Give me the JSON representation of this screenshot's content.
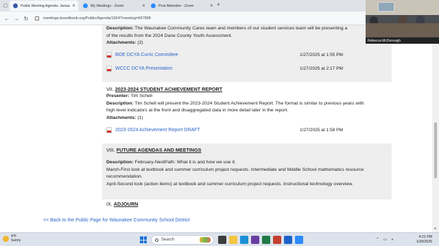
{
  "browser": {
    "tabs": [
      {
        "title": "Public Meeting Agenda: Janua",
        "active": true,
        "favicon_color": "#3b5ba9"
      },
      {
        "title": "My Meetings - Zoom",
        "active": false,
        "favicon_color": "#2d8cff"
      },
      {
        "title": "Post Attendee - Zoom",
        "active": false,
        "favicon_color": "#2d8cff"
      }
    ],
    "url": "meetings.boardbook.org/Public/Agenda/1924?meeting=667898"
  },
  "agenda": {
    "top_section": {
      "description_label": "Description:",
      "description_text": " The Waunakee Community Cares team and members of our student services team will be presenting a",
      "description_cont": "of the results from the 2024 Dane County Youth Assessment.",
      "attachments_label": "Attachments:",
      "attachments_count": " (2)",
      "attachments": [
        {
          "name": "BOE DCYA Curric Committee",
          "date": "1/27/2025 at 1:55 PM"
        },
        {
          "name": "WCCC DCYA Presentation",
          "date": "1/27/2025 at 2:17 PM"
        }
      ]
    },
    "item7": {
      "number": "VII.",
      "title": "2023-2024 STUDENT ACHIEVEMENT REPORT",
      "presenter_label": "Presenter:",
      "presenter": " Tim Schell",
      "description_label": "Description:",
      "description_line1": " Tim Schell will present the 2023-2024 Student Achievement Report.  The format is similar to previous years with",
      "description_line2": "high level indicators at the front and disaggregated data in more detail later in the report.",
      "attachments_label": "Attachments:",
      "attachments_count": " (1)",
      "attachments": [
        {
          "name": "2023-2024 Achievement Report DRAFT",
          "date": "1/27/2025 at 1:58 PM"
        }
      ]
    },
    "item8": {
      "number": "VIII.",
      "title": "FUTURE AGENDAS AND MEETINGS",
      "description_label": "Description:",
      "description_line1": " February-NextPath:  What it is and how we use it.",
      "line2": "March-First look at textbook and summer curriculum project requests.   Intermediate and Middle School mathematics resource",
      "line3": "recommendation.",
      "line4": "April-Second look (action items) at textbook and summer curriculum project requests.  Instructional technology overview."
    },
    "item9": {
      "number": "IX.",
      "title": "ADJOURN"
    },
    "back_link": "<< Back to the Public Page for Waunakee Community School District"
  },
  "video_overlay": {
    "participant_name": "Rebecca McDonough"
  },
  "taskbar": {
    "weather_temp": "4°F",
    "weather_desc": "Sunny",
    "search_placeholder": "Search",
    "time": "4:21 PM",
    "date": "1/29/2025"
  },
  "colors": {
    "link": "#2a64c8",
    "shaded_row": "#eeeeee",
    "windows_blue": "#1f72d6"
  }
}
